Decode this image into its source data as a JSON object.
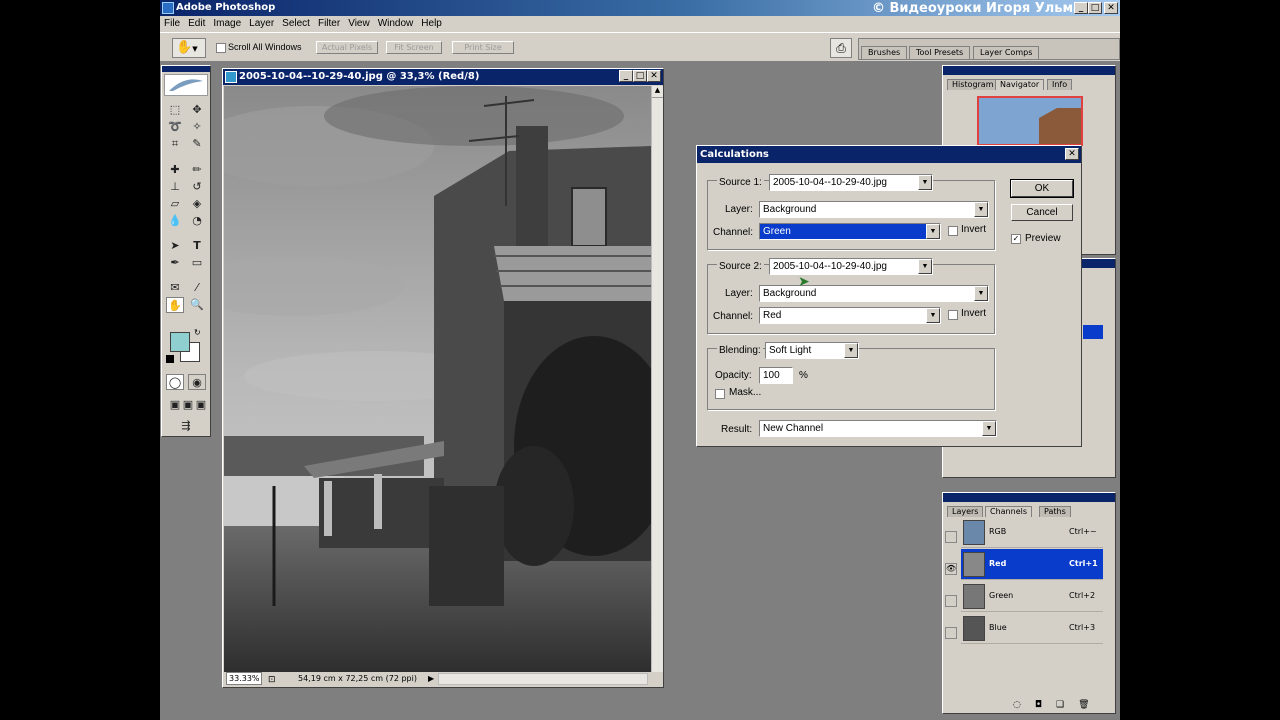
{
  "app": {
    "title": "Adobe Photoshop",
    "watermark": "© Видеоуроки Игоря Ульмана"
  },
  "menu": [
    "File",
    "Edit",
    "Image",
    "Layer",
    "Select",
    "Filter",
    "View",
    "Window",
    "Help"
  ],
  "options_bar": {
    "scroll_all_label": "Scroll All Windows",
    "actual_pixels": "Actual Pixels",
    "fit_screen": "Fit Screen",
    "print_size": "Print Size",
    "palette_tabs": [
      "Brushes",
      "Tool Presets",
      "Layer Comps"
    ]
  },
  "document": {
    "title": "2005-10-04--10-29-40.jpg @ 33,3% (Red/8)",
    "zoom": "33.33%",
    "size_info": "54,19 cm x 72,25 cm (72 ppi)"
  },
  "calculations": {
    "title": "Calculations",
    "source1_label": "Source 1:",
    "source1_value": "2005-10-04--10-29-40.jpg",
    "layer_label": "Layer:",
    "layer1_value": "Background",
    "channel_label": "Channel:",
    "channel1_value": "Green",
    "invert_label": "Invert",
    "source2_label": "Source 2:",
    "source2_value": "2005-10-04--10-29-40.jpg",
    "layer2_value": "Background",
    "channel2_value": "Red",
    "blending_label": "Blending:",
    "blending_value": "Soft Light",
    "opacity_label": "Opacity:",
    "opacity_value": "100",
    "percent": "%",
    "mask_label": "Mask...",
    "result_label": "Result:",
    "result_value": "New Channel",
    "ok": "OK",
    "cancel": "Cancel",
    "preview_label": "Preview"
  },
  "navigator_panel": {
    "tabs": [
      "Histogram",
      "Navigator",
      "Info"
    ]
  },
  "channels_panel": {
    "tabs": [
      "Layers",
      "Channels",
      "Paths"
    ],
    "rows": [
      {
        "name": "RGB",
        "shortcut": "Ctrl+~"
      },
      {
        "name": "Red",
        "shortcut": "Ctrl+1"
      },
      {
        "name": "Green",
        "shortcut": "Ctrl+2"
      },
      {
        "name": "Blue",
        "shortcut": "Ctrl+3"
      }
    ]
  },
  "colors": {
    "title_blue": "#0a246a",
    "selection_blue": "#0a3ccc",
    "foreground_swatch": "#8fcfcf"
  }
}
